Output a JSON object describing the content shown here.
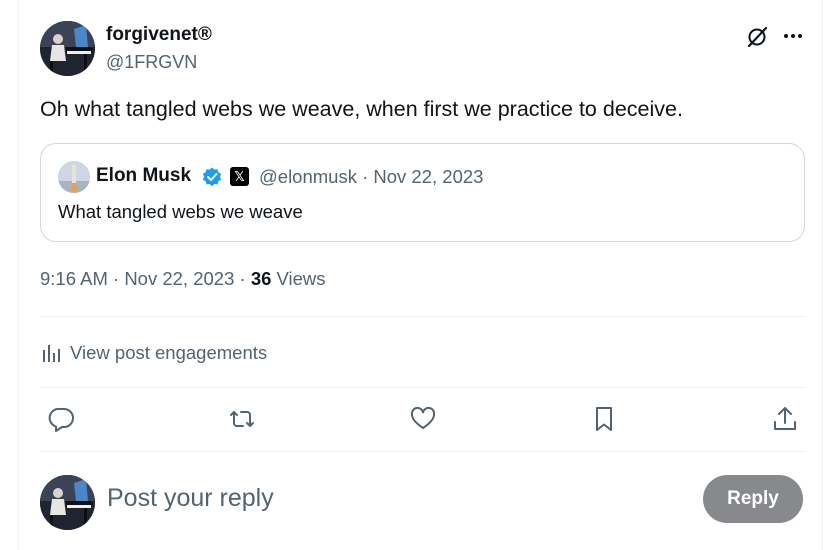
{
  "post": {
    "author_name": "forgivenet",
    "author_badge": "®",
    "author_handle": "@1FRGVN",
    "text": "Oh what tangled webs we weave, when first we practice to deceive.",
    "timestamp": "9:16 AM · Nov 22, 2023 · ",
    "views_count": "36",
    "views_label": " Views"
  },
  "quote": {
    "author_name": "Elon Musk",
    "x_badge": "𝕏",
    "meta": "@elonmusk · Nov 22, 2023",
    "text": "What tangled webs we weave"
  },
  "engagements_label": "View post engagements",
  "actions": {
    "reply_icon": "comment-icon",
    "repost_icon": "repost-icon",
    "like_icon": "heart-icon",
    "bookmark_icon": "bookmark-icon",
    "share_icon": "share-icon"
  },
  "composer": {
    "placeholder": "Post your reply",
    "reply_button_label": "Reply"
  },
  "colors": {
    "text_primary": "#0f1419",
    "text_secondary": "#536471",
    "border": "#cfd9de",
    "divider": "#eff3f4",
    "verified": "#1d9bf0",
    "reply_button_disabled": "#87898c"
  }
}
